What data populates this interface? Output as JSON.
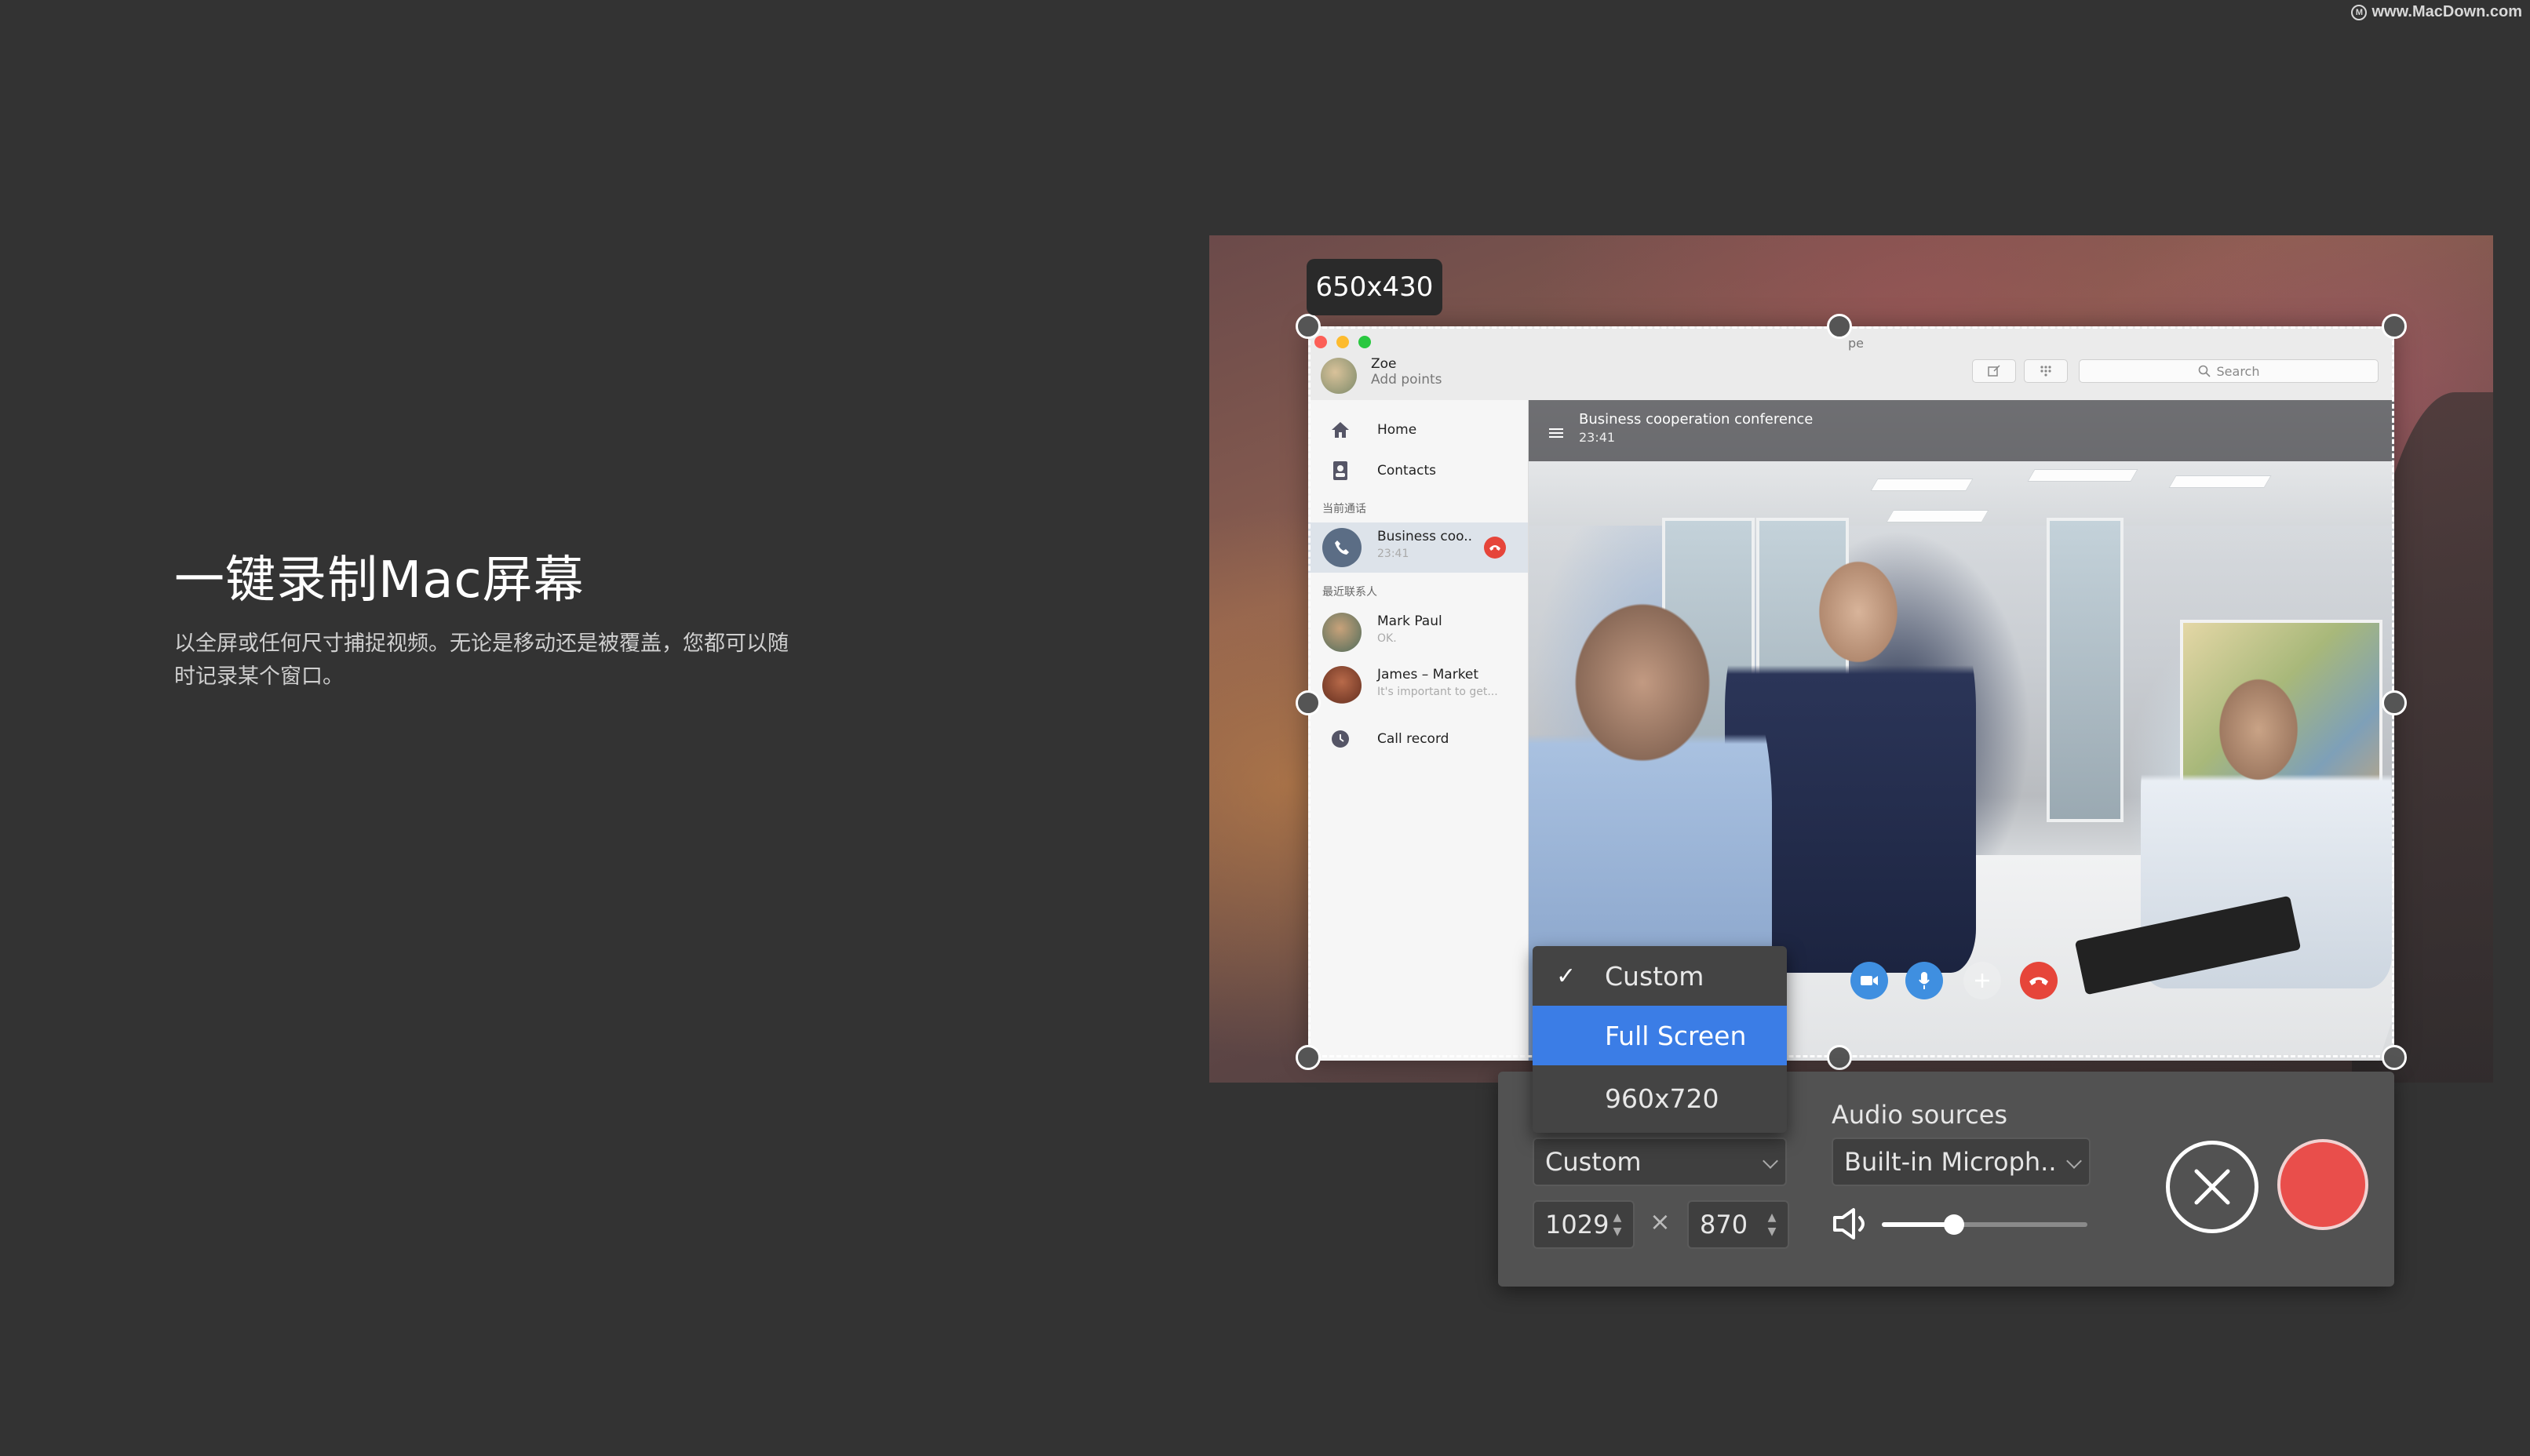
{
  "watermark": {
    "text": "www.MacDown.com",
    "logo": "M"
  },
  "hero": {
    "title": "一键录制Mac屏幕",
    "description": "以全屏或任何尺寸捕捉视频。无论是移动还是被覆盖，您都可以随时记录某个窗口。"
  },
  "selection": {
    "size_label": "650x430"
  },
  "app": {
    "name": "pe",
    "user_name": "Zoe",
    "user_status": "Add points",
    "search_placeholder": "Search",
    "sidebar": {
      "home": "Home",
      "contacts": "Contacts",
      "section_current": "当前通话",
      "current_call_name": "Business coo..",
      "current_call_time": "23:41",
      "section_recent": "最近联系人",
      "contact1_name": "Mark Paul",
      "contact1_msg": "OK.",
      "contact2_name": "James – Market",
      "contact2_msg": "It's important to get...",
      "call_record": "Call record"
    },
    "call": {
      "title": "Business cooperation conference",
      "time": "23:41"
    }
  },
  "dropdown": {
    "items": [
      {
        "label": "Custom",
        "checked": true
      },
      {
        "label": "Full Screen",
        "highlighted": true
      },
      {
        "label": "960x720"
      }
    ]
  },
  "panel": {
    "size_select": "Custom",
    "width_value": "1029",
    "height_value": "870",
    "times_symbol": "×",
    "audio_label": "Audio sources",
    "audio_source": "Built-in Microph..",
    "volume": 0.35
  },
  "colors": {
    "accent": "#3b7de6",
    "record": "#e94e4b",
    "background": "#333333"
  }
}
